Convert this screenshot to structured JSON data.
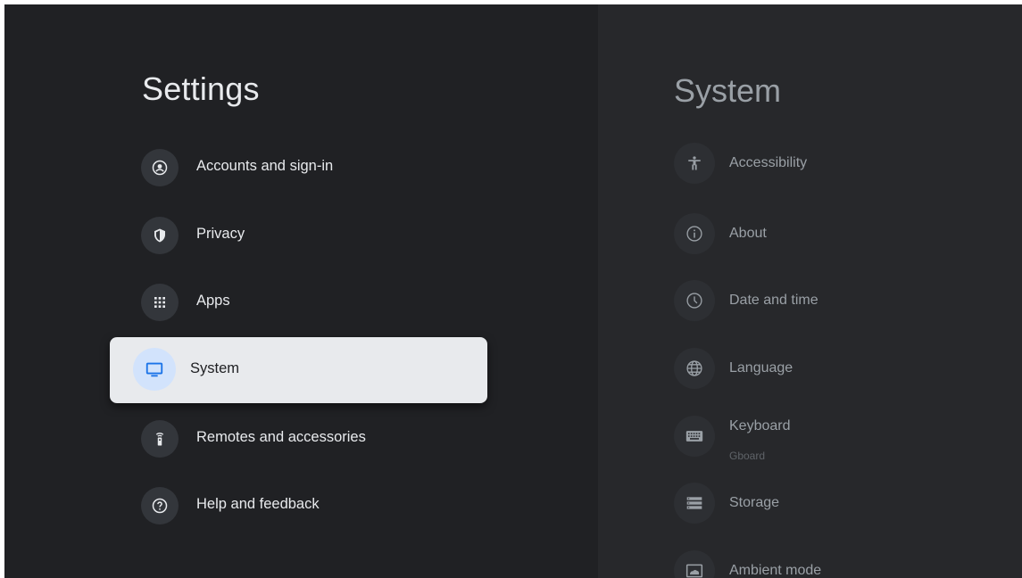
{
  "settings": {
    "title": "Settings",
    "items": [
      {
        "label": "Accounts and sign-in",
        "icon": "account-circle-icon"
      },
      {
        "label": "Privacy",
        "icon": "shield-icon"
      },
      {
        "label": "Apps",
        "icon": "apps-grid-icon"
      },
      {
        "label": "System",
        "icon": "tv-icon",
        "selected": true
      },
      {
        "label": "Remotes and accessories",
        "icon": "remote-icon"
      },
      {
        "label": "Help and feedback",
        "icon": "help-icon"
      }
    ]
  },
  "system": {
    "title": "System",
    "items": [
      {
        "label": "Accessibility",
        "icon": "accessibility-icon"
      },
      {
        "label": "About",
        "icon": "info-icon"
      },
      {
        "label": "Date and time",
        "icon": "clock-icon"
      },
      {
        "label": "Language",
        "icon": "globe-icon"
      },
      {
        "label": "Keyboard",
        "sublabel": "Gboard",
        "icon": "keyboard-icon"
      },
      {
        "label": "Storage",
        "icon": "storage-icon"
      },
      {
        "label": "Ambient mode",
        "icon": "ambient-mode-icon"
      }
    ]
  },
  "colors": {
    "background": "#202124",
    "panel": "#27282b",
    "selected_bg": "#e8eaed",
    "selected_icon_bg": "#d2e3fc",
    "accent": "#1a73e8"
  }
}
